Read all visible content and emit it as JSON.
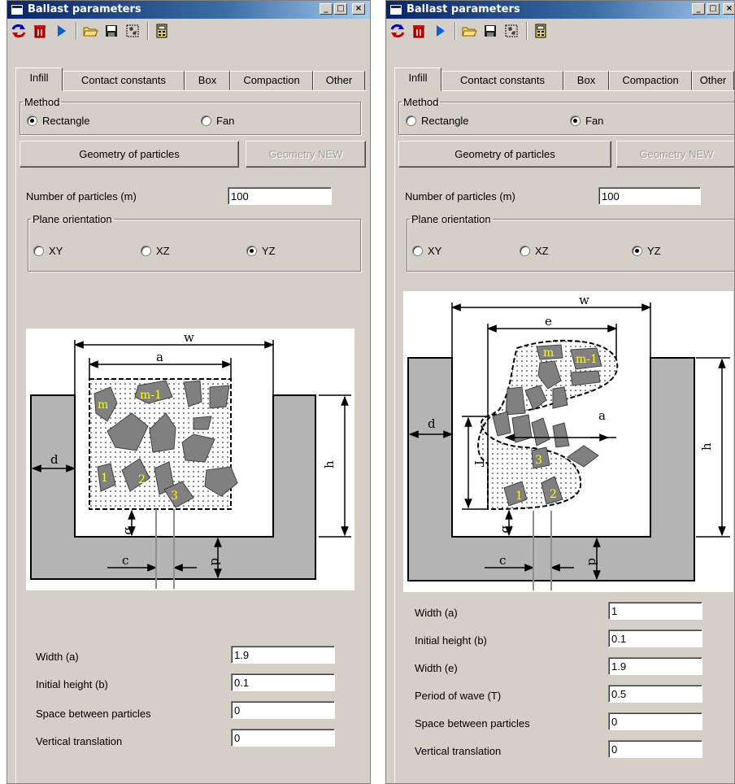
{
  "left": {
    "title": "Ballast parameters",
    "titlebar_buttons": [
      "_",
      "□",
      "×"
    ],
    "tabs": [
      "Infill",
      "Contact constants",
      "Box",
      "Compaction",
      "Other"
    ],
    "method": {
      "legend": "Method",
      "rectangle": "Rectangle",
      "fan": "Fan",
      "selected": "Rectangle"
    },
    "geometry_button": "Geometry of particles",
    "geometry_new_button": "Geometry NEW",
    "num_particles_label": "Number of particles (m)",
    "num_particles_value": "100",
    "plane": {
      "legend": "Plane orientation",
      "xy": "XY",
      "xz": "XZ",
      "yz": "YZ",
      "selected": "YZ"
    },
    "diagram_labels": {
      "w": "w",
      "a": "a",
      "d_left": "d",
      "h": "h",
      "b": "b",
      "c": "c",
      "d_bottom": "d",
      "m": "m",
      "m1": "m-1",
      "p1": "1",
      "p2": "2",
      "p3": "3"
    },
    "fields": [
      {
        "label": "Width (a)",
        "value": "1.9"
      },
      {
        "label": "Initial height (b)",
        "value": "0.1"
      },
      {
        "label": "Space between particles",
        "value": "0"
      },
      {
        "label": "Vertical translation",
        "value": "0"
      }
    ]
  },
  "right": {
    "title": "Ballast parameters",
    "titlebar_buttons": [
      "_",
      "□",
      "×"
    ],
    "tabs": [
      "Infill",
      "Contact constants",
      "Box",
      "Compaction",
      "Other"
    ],
    "method": {
      "legend": "Method",
      "rectangle": "Rectangle",
      "fan": "Fan",
      "selected": "Fan"
    },
    "geometry_button": "Geometry of particles",
    "geometry_new_button": "Geometry NEW",
    "num_particles_label": "Number of particles (m)",
    "num_particles_value": "100",
    "plane": {
      "legend": "Plane orientation",
      "xy": "XY",
      "xz": "XZ",
      "yz": "YZ",
      "selected": "YZ"
    },
    "diagram_labels": {
      "w": "w",
      "e": "e",
      "a": "a",
      "d_left": "d",
      "T": "T",
      "h": "h",
      "b": "b",
      "c": "c",
      "d_bottom": "d",
      "m": "m",
      "m1": "m-1",
      "p1": "1",
      "p2": "2",
      "p3": "3"
    },
    "fields": [
      {
        "label": "Width (a)",
        "value": "1"
      },
      {
        "label": "Initial height (b)",
        "value": "0.1"
      },
      {
        "label": "Width (e)",
        "value": "1.9"
      },
      {
        "label": "Period of wave (T)",
        "value": "0.5"
      },
      {
        "label": "Space between particles",
        "value": "0"
      },
      {
        "label": "Vertical translation",
        "value": "0"
      }
    ]
  },
  "icons": [
    "refresh-icon",
    "delete-icon",
    "run-icon",
    "open-folder-icon",
    "save-icon",
    "particles-icon",
    "calculator-icon"
  ],
  "colors": {
    "title_start": "#0a246a",
    "title_end": "#a6caf0",
    "face": "#d4d0c8",
    "rock": "#808080",
    "label_yellow": "#ffff00"
  }
}
